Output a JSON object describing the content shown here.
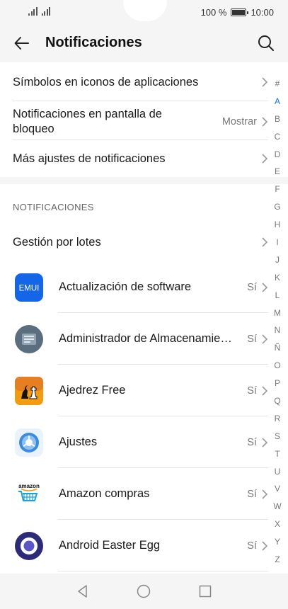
{
  "status_bar": {
    "battery_text": "100 %",
    "time": "10:00",
    "battery_level": 1.0
  },
  "header": {
    "title": "Notificaciones",
    "back_icon": "arrow-left-icon",
    "search_icon": "search-icon"
  },
  "settings": {
    "app_icon_badges": {
      "label": "Símbolos en iconos de aplicaciones"
    },
    "lock_screen": {
      "label": "Notificaciones en pantalla de bloqueo",
      "value": "Mostrar"
    },
    "more_settings": {
      "label": "Más ajustes de notificaciones"
    }
  },
  "section": {
    "title": "NOTIFICACIONES",
    "batch": {
      "label": "Gestión por lotes"
    }
  },
  "apps": [
    {
      "name": "Actualización de software",
      "status": "Sí",
      "icon": "emui-icon",
      "icon_text": "EMUI"
    },
    {
      "name": "Administrador de Almacenamiento",
      "status": "Sí",
      "icon": "storage-manager-icon"
    },
    {
      "name": "Ajedrez Free",
      "status": "Sí",
      "icon": "chess-icon"
    },
    {
      "name": "Ajustes",
      "status": "Sí",
      "icon": "settings-gear-icon"
    },
    {
      "name": "Amazon compras",
      "status": "Sí",
      "icon": "amazon-icon",
      "icon_text": "amazon"
    },
    {
      "name": "Android Easter Egg",
      "status": "Sí",
      "icon": "easter-egg-icon"
    }
  ],
  "index_letters": [
    "#",
    "A",
    "B",
    "C",
    "D",
    "E",
    "F",
    "G",
    "H",
    "I",
    "J",
    "K",
    "L",
    "M",
    "N",
    "Ñ",
    "O",
    "P",
    "Q",
    "R",
    "S",
    "T",
    "U",
    "V",
    "W",
    "X",
    "Y",
    "Z"
  ],
  "index_active": "A",
  "nav_bar": {
    "back": "triangle-back-icon",
    "home": "circle-home-icon",
    "recents": "square-recents-icon"
  },
  "colors": {
    "accent": "#1a73e8",
    "background": "#f5f5f5",
    "card": "#ffffff"
  }
}
